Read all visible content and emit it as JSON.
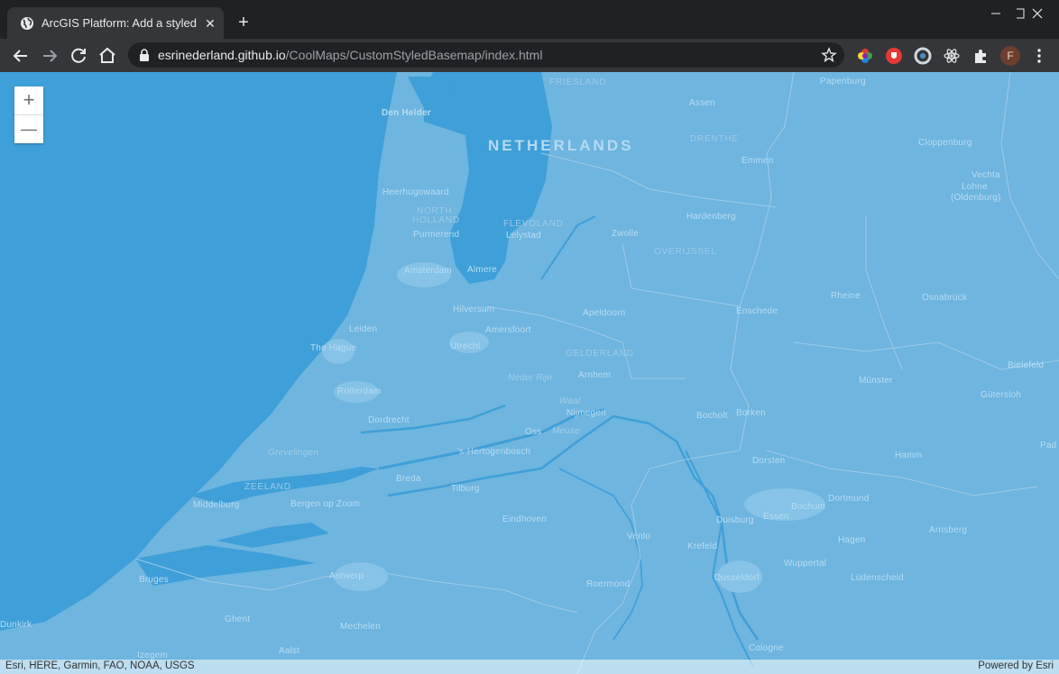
{
  "browser": {
    "tab": {
      "title": "ArcGIS Platform: Add a styled ba",
      "icon": "globe-icon",
      "close_label": "✕"
    },
    "new_tab_label": "+",
    "url": {
      "host": "esrinederland.github.io",
      "path": "/CoolMaps/CustomStyledBasemap/index.html"
    },
    "avatar_letter": "F",
    "colors": {
      "titlebar": "#202124",
      "toolbar": "#35363a",
      "omnibox": "#202124"
    }
  },
  "map": {
    "colors": {
      "land": "#6eb5df",
      "water": "#3f9fd8",
      "borders": "#9dcbe8"
    },
    "zoom": {
      "in_label": "+",
      "out_label": "—"
    },
    "labels": {
      "netherlands": "NETHERLANDS",
      "friesland": "FRIESLAND",
      "drenthe": "DRENTHE",
      "overijssel": "OVERIJSSEL",
      "gelderland": "GELDERLAND",
      "north_holland_1": "NORTH",
      "north_holland_2": "HOLLAND",
      "flevoland": "FLEVOLAND",
      "zeeland": "ZEELAND",
      "den_helder": "Den Helder",
      "heerhugowaard": "Heerhugowaard",
      "purmerend": "Purmerend",
      "lelystad": "Lelystad",
      "amsterdam": "Amsterdam",
      "almere": "Almere",
      "hilversum": "Hilversum",
      "leiden": "Leiden",
      "the_hague": "The Hague",
      "utrecht": "Utrecht",
      "amersfoort": "Amersfoort",
      "apeldoorn": "Apeldoorn",
      "rotterdam": "Rotterdam",
      "dordrecht": "Dordrecht",
      "arnhem": "Arnhem",
      "nijmegen": "Nijmegen",
      "oss": "Oss",
      "s_hertogenbosch": "'s-Hertogenbosch",
      "breda": "Breda",
      "tilburg": "Tilburg",
      "eindhoven": "Eindhoven",
      "venlo": "Venlo",
      "roermond": "Roermond",
      "middelburg": "Middelburg",
      "bergen_op_zoom": "Bergen op Zoom",
      "antwerp": "Antwerp",
      "bruges": "Bruges",
      "ghent": "Ghent",
      "mechelen": "Mechelen",
      "aalst": "Aalst",
      "dunkirk": "Dunkirk",
      "izegem": "Izegem",
      "assen": "Assen",
      "emmen": "Emmen",
      "zwolle": "Zwolle",
      "hardenberg": "Hardenberg",
      "enschede": "Enschede",
      "bocholt": "Bocholt",
      "borken": "Borken",
      "dorsten": "Dorsten",
      "duisburg": "Duisburg",
      "essen": "Essen",
      "bochum": "Bochum",
      "dortmund": "Dortmund",
      "krefeld": "Krefeld",
      "dusseldorf": "Dusseldorf",
      "wuppertal": "Wuppertal",
      "hagen": "Hagen",
      "ludenscheid": "Lüdenscheid",
      "cologne": "Cologne",
      "hamm": "Hamm",
      "arnsberg": "Arnsberg",
      "munster": "Münster",
      "gutersloh": "Gütersloh",
      "bielefeld": "Bielefeld",
      "rheine": "Rheine",
      "osnabruck": "Osnabrück",
      "papenburg": "Papenburg",
      "cloppenburg": "Cloppenburg",
      "vechta_1": "Vechta",
      "vechta_2": "Lohne",
      "vechta_3": "(Oldenburg)",
      "pad": "Pad",
      "neder_rijn": "Neder Rijn",
      "waal": "Waal",
      "meuse": "Meuse",
      "grevelingen": "Grevelingen"
    },
    "attribution": {
      "left": "Esri, HERE, Garmin, FAO, NOAA, USGS",
      "right": "Powered by Esri"
    }
  }
}
